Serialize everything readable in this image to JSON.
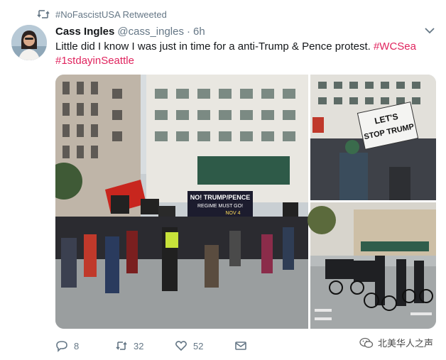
{
  "retweet_banner": {
    "text": "#NoFascistUSA Retweeted",
    "icon": "retweet-icon"
  },
  "tweet": {
    "author_name": "Cass Ingles",
    "author_handle": "@cass_ingles",
    "separator": "·",
    "time": "6h",
    "text_main": "Little did I know I was just in time for a anti-Trump & Pence protest. ",
    "hashtags": [
      "#WCSea",
      "#1stdayinSeattle"
    ]
  },
  "media": {
    "sign_main_line1": "NO! TRUMP/PENCE",
    "sign_main_line2": "REGIME MUST GO!",
    "sign_main_line3": "NOV 4",
    "sign_right_line1": "LET'S",
    "sign_right_line2": "STOP TRUMP"
  },
  "actions": {
    "replies": "8",
    "retweets": "32",
    "likes": "52"
  },
  "watermark": {
    "text": "北美华人之声"
  },
  "colors": {
    "hashtag": "#e0245e",
    "muted": "#657786",
    "text": "#14171a"
  }
}
